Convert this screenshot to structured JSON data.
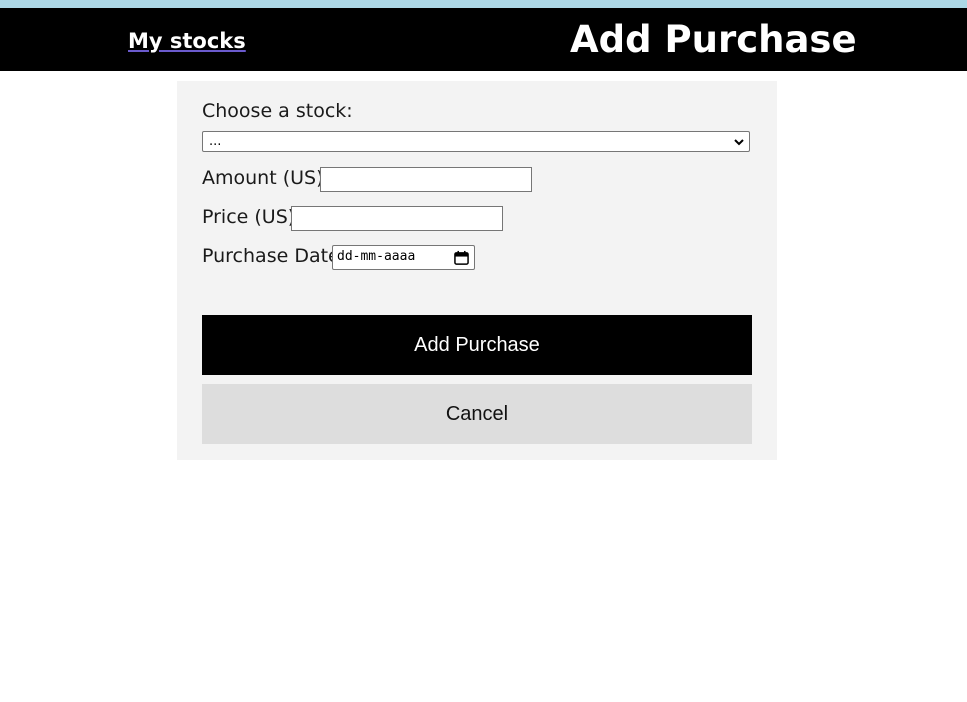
{
  "header": {
    "home_link": "My stocks",
    "title": "Add Purchase"
  },
  "form": {
    "stock_label": "Choose a stock:",
    "stock_selected": "...",
    "amount_label": "Amount (US):",
    "amount_value": "",
    "price_label": "Price (US):",
    "price_value": "",
    "date_label": "Purchase Date:",
    "date_placeholder": "dd-mm-aaaa",
    "submit_label": "Add Purchase",
    "cancel_label": "Cancel"
  },
  "icons": {
    "select_arrow": "chevron-down-icon",
    "date_picker": "calendar-icon"
  },
  "colors": {
    "header_bg": "#000000",
    "top_strip": "#add8e6",
    "card_bg": "#f3f3f3",
    "primary_button": "#000000",
    "secondary_button": "#dddddd"
  }
}
